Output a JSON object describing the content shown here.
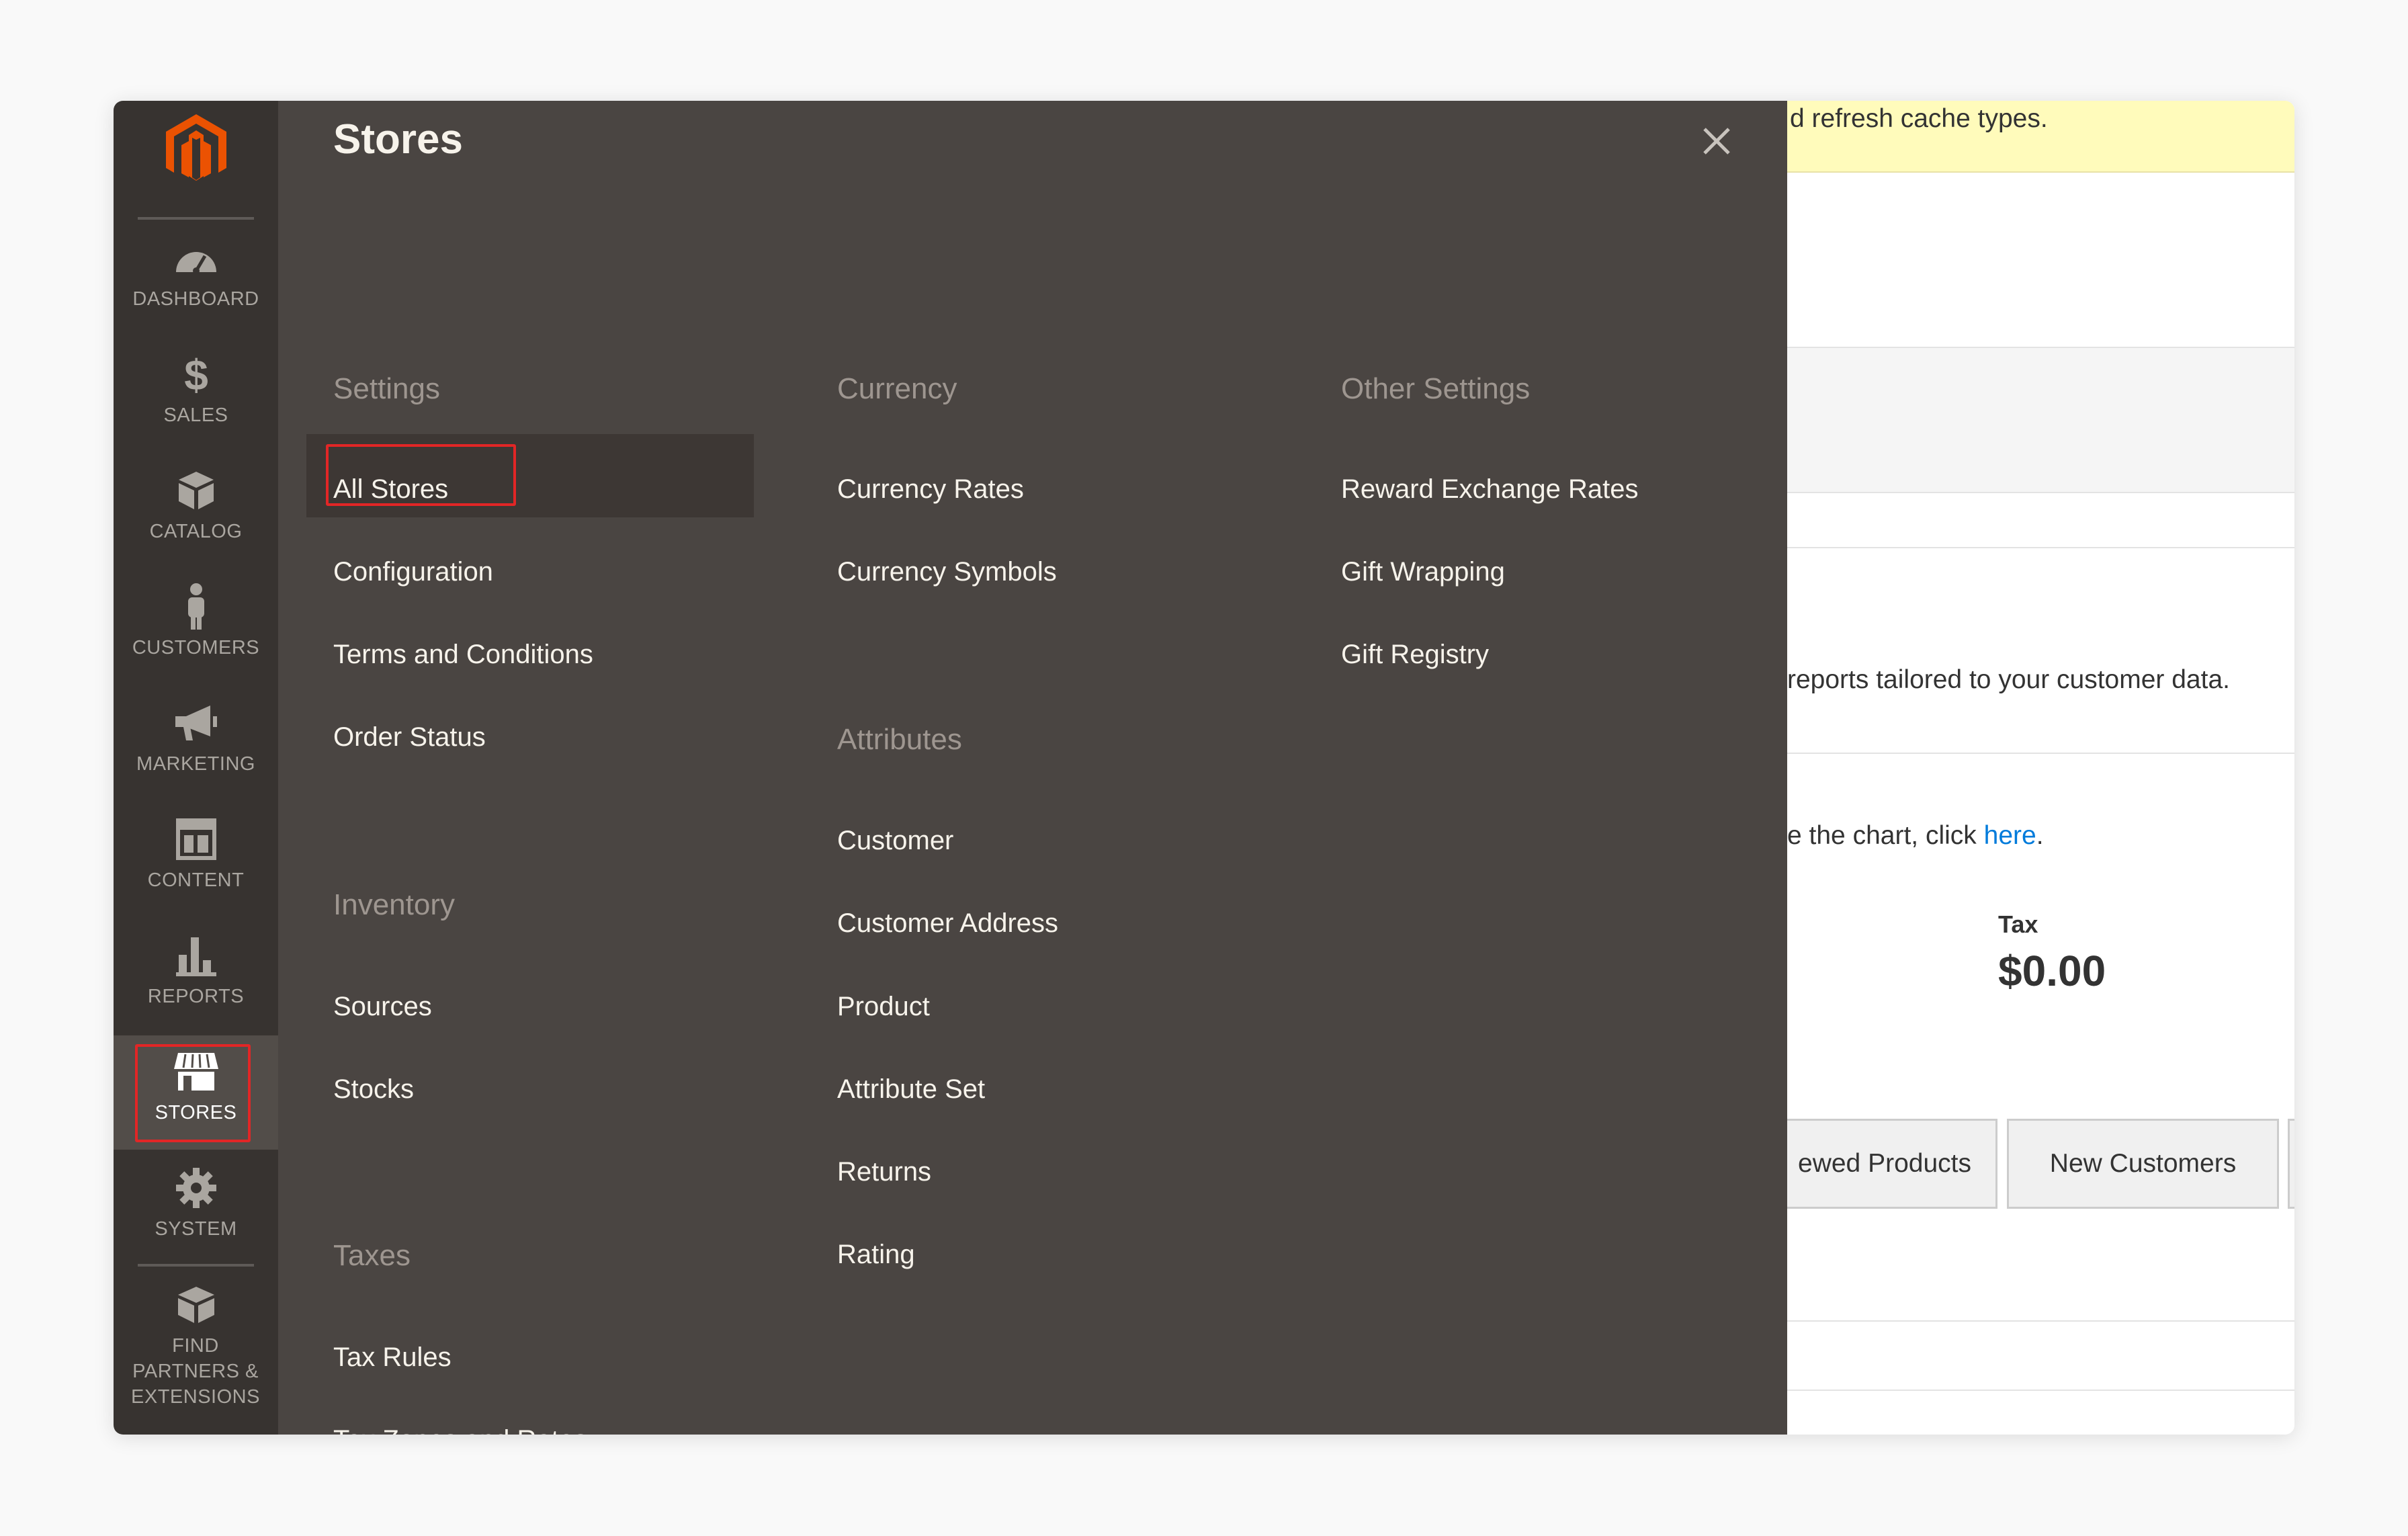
{
  "nav": {
    "items": [
      {
        "label": "DASHBOARD",
        "icon": "dashboard-icon"
      },
      {
        "label": "SALES",
        "icon": "dollar-icon"
      },
      {
        "label": "CATALOG",
        "icon": "box-icon"
      },
      {
        "label": "CUSTOMERS",
        "icon": "person-icon"
      },
      {
        "label": "MARKETING",
        "icon": "megaphone-icon"
      },
      {
        "label": "CONTENT",
        "icon": "layout-icon"
      },
      {
        "label": "REPORTS",
        "icon": "bar-chart-icon"
      },
      {
        "label": "STORES",
        "icon": "storefront-icon",
        "active": true
      },
      {
        "label": "SYSTEM",
        "icon": "gear-icon"
      },
      {
        "label": "FIND PARTNERS & EXTENSIONS",
        "icon": "cube-stack-icon"
      }
    ]
  },
  "flyout": {
    "title": "Stores",
    "settings": {
      "heading": "Settings",
      "links": [
        "All Stores",
        "Configuration",
        "Terms and Conditions",
        "Order Status"
      ]
    },
    "inventory": {
      "heading": "Inventory",
      "links": [
        "Sources",
        "Stocks"
      ]
    },
    "taxes": {
      "heading": "Taxes",
      "links": [
        "Tax Rules",
        "Tax Zones and Rates"
      ]
    },
    "currency": {
      "heading": "Currency",
      "links": [
        "Currency Rates",
        "Currency Symbols"
      ]
    },
    "attributes": {
      "heading": "Attributes",
      "links": [
        "Customer",
        "Customer Address",
        "Product",
        "Attribute Set",
        "Returns",
        "Rating"
      ]
    },
    "other": {
      "heading": "Other Settings",
      "links": [
        "Reward Exchange Rates",
        "Gift Wrapping",
        "Gift Registry"
      ]
    }
  },
  "background": {
    "notice": "d refresh cache types.",
    "reports_text": "reports tailored to your customer data.",
    "chart_text": "e the chart, click ",
    "chart_link": "here",
    "chart_after": ".",
    "tax_label": "Tax",
    "tax_value": "$0.00",
    "tabs": [
      "ewed Products",
      "New Customers"
    ]
  },
  "colors": {
    "nav_bg": "#373330",
    "flyout_bg": "#4a4542",
    "highlight": "#e22626",
    "brand": "#eb5202"
  }
}
